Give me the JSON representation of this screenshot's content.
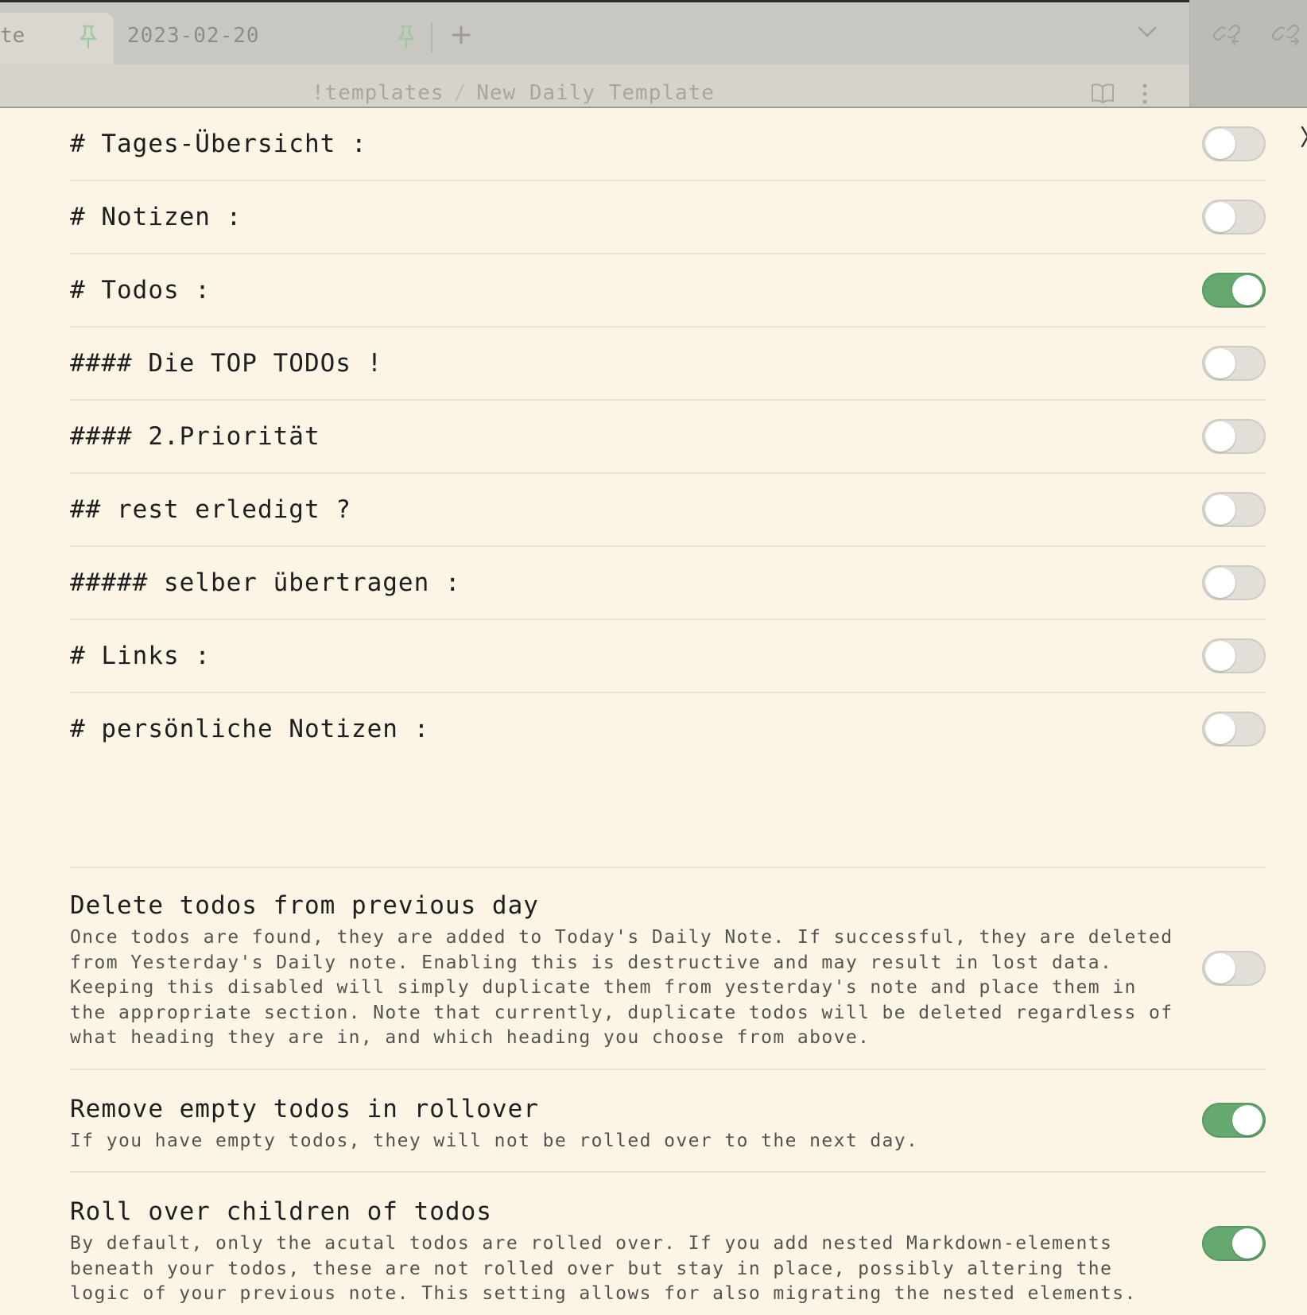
{
  "tabs": {
    "active_title_fragment": "te",
    "second_title": "2023-02-20",
    "new_tab_symbol": "+",
    "pin_icon": "pin-icon",
    "dropdown_icon": "chevron-down-icon",
    "link_icons": [
      "incoming-links-icon",
      "outgoing-links-icon"
    ]
  },
  "breadcrumb": {
    "folder": "!templates",
    "separator": "/",
    "file": "New Daily Template"
  },
  "heading_options": [
    {
      "label": "# Tages-Übersicht :",
      "enabled": false
    },
    {
      "label": "# Notizen :",
      "enabled": false
    },
    {
      "label": "# Todos :",
      "enabled": true
    },
    {
      "label": "#### Die TOP TODOs !",
      "enabled": false
    },
    {
      "label": "#### 2.Priorität",
      "enabled": false
    },
    {
      "label": "## rest erledigt ?",
      "enabled": false
    },
    {
      "label": "##### selber übertragen :",
      "enabled": false
    },
    {
      "label": "# Links :",
      "enabled": false
    },
    {
      "label": "# persönliche Notizen :",
      "enabled": false
    }
  ],
  "settings": [
    {
      "name": "Delete todos from previous day",
      "description": "Once todos are found, they are added to Today's Daily Note. If successful, they are deleted from Yesterday's Daily note. Enabling this is destructive and may result in lost data. Keeping this disabled will simply duplicate them from yesterday's note and place them in the appropriate section. Note that currently, duplicate todos will be deleted regardless of what heading they are in, and which heading you choose from above.",
      "enabled": false
    },
    {
      "name": "Remove empty todos in rollover",
      "description": "If you have empty todos, they will not be rolled over to the next day.",
      "enabled": true
    },
    {
      "name": "Roll over children of todos",
      "description": "By default, only the acutal todos are rolled over. If you add nested Markdown-elements beneath your todos, these are not rolled over but stay in place, possibly altering the logic of your previous note. This setting allows for also migrating the nested elements.",
      "enabled": true
    }
  ],
  "colors": {
    "background": "#fcf5e6",
    "toggle_on": "#66a970",
    "toggle_off": "#e2dfd9",
    "pin_active": "#9fc9a3"
  }
}
